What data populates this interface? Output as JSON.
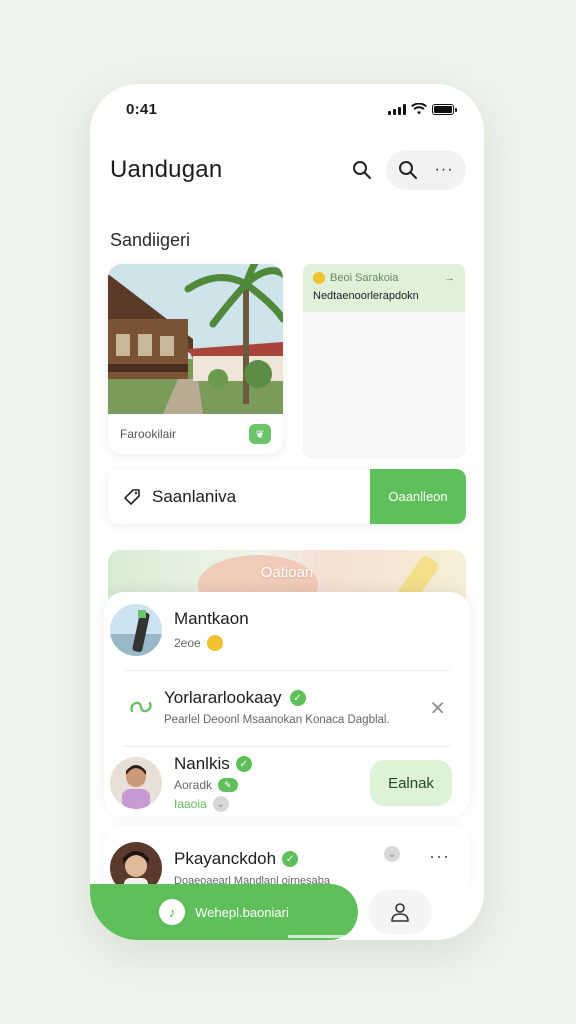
{
  "status": {
    "time": "0:41"
  },
  "header": {
    "title": "Uandugan"
  },
  "section": {
    "title": "Sandiigeri"
  },
  "photo_card": {
    "caption": "Farookilair"
  },
  "note_card": {
    "label": "Beoi Sarakoia",
    "subtitle": "Nedtaenoorlerapdokn"
  },
  "action_bar": {
    "label": "Saanlaniva",
    "button": "Oaanlleon"
  },
  "banner": {
    "title": "Oatioan"
  },
  "list": {
    "item1": {
      "title": "Mantkaon",
      "sub": "2eoe"
    },
    "item2": {
      "title": "Yorlararlookaay",
      "sub": "Pearlel Deoonl Msaanokan Konaca Dagblal."
    },
    "item3": {
      "title": "Nanlkis",
      "sub1": "Aoradk",
      "sub2": "Iaaoia",
      "button": "Ealnak"
    },
    "item4": {
      "title": "Pkayanckdoh",
      "sub": "Doaeoaearl Mandlanl oirnesaba"
    }
  },
  "tabbar": {
    "home_label": "Wehepl.baoniari"
  },
  "colors": {
    "accent": "#5fbf5a",
    "accent_light": "#def2d8",
    "background": "#eef3ec"
  }
}
